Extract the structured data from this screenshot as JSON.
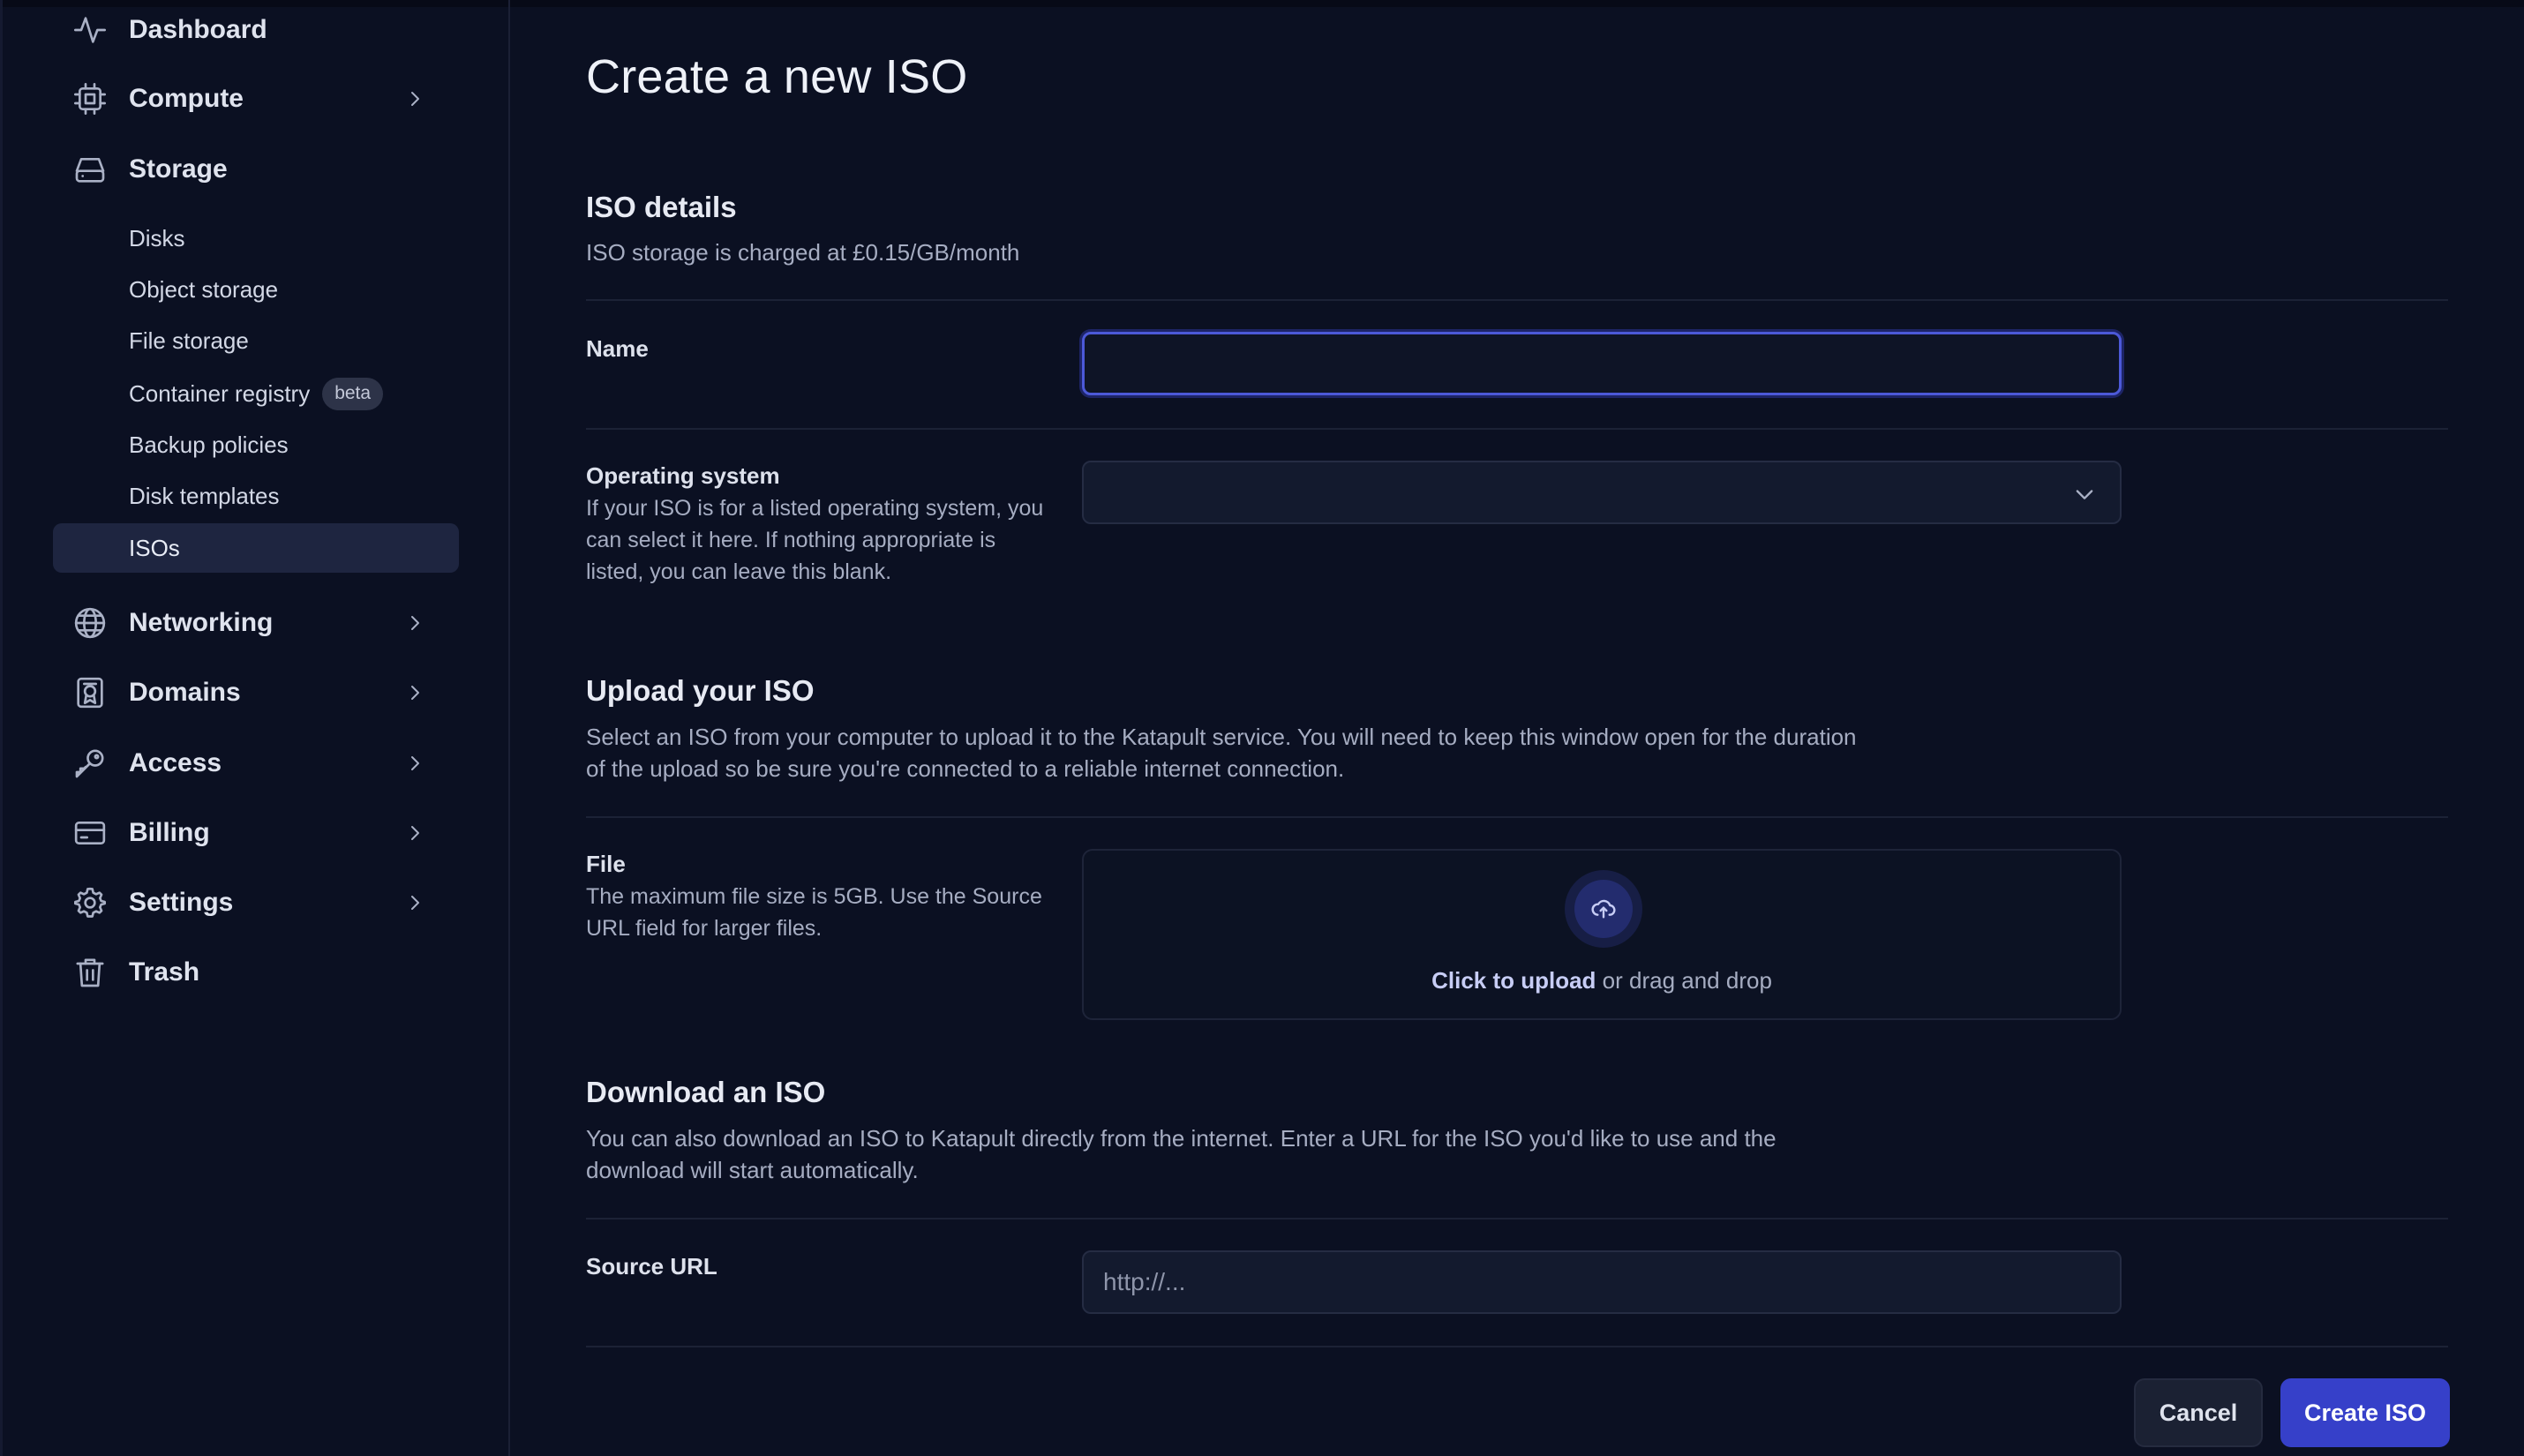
{
  "sidebar": {
    "items": [
      {
        "label": "Dashboard",
        "icon": "activity-icon",
        "has_chevron": false
      },
      {
        "label": "Compute",
        "icon": "cpu-icon",
        "has_chevron": true
      },
      {
        "label": "Storage",
        "icon": "hard-drive-icon",
        "has_chevron": false
      },
      {
        "label": "Networking",
        "icon": "globe-icon",
        "has_chevron": true
      },
      {
        "label": "Domains",
        "icon": "domain-badge-icon",
        "has_chevron": true
      },
      {
        "label": "Access",
        "icon": "key-icon",
        "has_chevron": true
      },
      {
        "label": "Billing",
        "icon": "credit-card-icon",
        "has_chevron": true
      },
      {
        "label": "Settings",
        "icon": "gear-icon",
        "has_chevron": true
      },
      {
        "label": "Trash",
        "icon": "trash-icon",
        "has_chevron": false
      }
    ],
    "storage_subitems": [
      {
        "label": "Disks"
      },
      {
        "label": "Object storage"
      },
      {
        "label": "File storage"
      },
      {
        "label": "Container registry",
        "badge": "beta"
      },
      {
        "label": "Backup policies"
      },
      {
        "label": "Disk templates"
      },
      {
        "label": "ISOs",
        "active": true
      }
    ]
  },
  "main": {
    "title": "Create a new ISO",
    "iso_details": {
      "heading": "ISO details",
      "description": "ISO storage is charged at £0.15/GB/month",
      "name_label": "Name",
      "name_value": "",
      "os_label": "Operating system",
      "os_help": "If your ISO is for a listed operating system, you can select it here. If nothing appropriate is listed, you can leave this blank.",
      "os_value": ""
    },
    "upload": {
      "heading": "Upload your ISO",
      "description": "Select an ISO from your computer to upload it to the Katapult service. You will need to keep this window open for the duration of the upload so be sure you're connected to a reliable internet connection.",
      "file_label": "File",
      "file_help": "The maximum file size is 5GB. Use the Source URL field for larger files.",
      "click_text": "Click to upload",
      "drag_text": " or drag and drop"
    },
    "download": {
      "heading": "Download an ISO",
      "description": "You can also download an ISO to Katapult directly from the internet. Enter a URL for the ISO you'd like to use and the download will start automatically.",
      "source_label": "Source URL",
      "source_placeholder": "http://...",
      "source_value": ""
    },
    "actions": {
      "cancel_label": "Cancel",
      "create_label": "Create ISO"
    }
  },
  "colors": {
    "background": "#0b1022",
    "accent": "#3640c9",
    "focus_ring": "#4c59d8",
    "active_nav": "#1e2540"
  }
}
